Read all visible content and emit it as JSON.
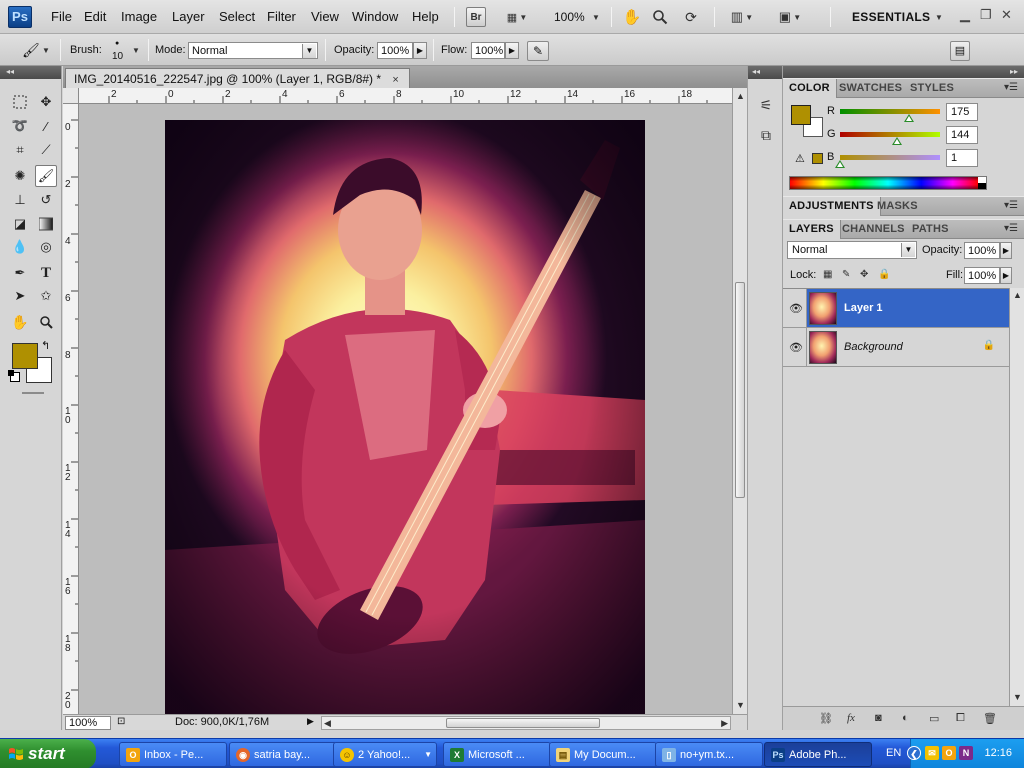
{
  "menubar": {
    "logo": "Ps",
    "items": [
      "File",
      "Edit",
      "Image",
      "Layer",
      "Select",
      "Filter",
      "View",
      "Window",
      "Help"
    ],
    "bridge_label": "Br",
    "zoom": "100%",
    "workspace": "ESSENTIALS"
  },
  "options": {
    "brush_label": "Brush:",
    "brush_size": "10",
    "mode_label": "Mode:",
    "mode_value": "Normal",
    "opacity_label": "Opacity:",
    "opacity_value": "100%",
    "flow_label": "Flow:",
    "flow_value": "100%"
  },
  "tools": {
    "foreground_color": "#af9001",
    "background_color": "#ffffff"
  },
  "document": {
    "tab_title": "IMG_20140516_222547.jpg @ 100% (Layer 1, RGB/8#) *",
    "close_glyph": "×",
    "ruler_h": [
      "2",
      "0",
      "2",
      "4",
      "6",
      "8",
      "10",
      "12",
      "14",
      "16",
      "18"
    ],
    "ruler_v": [
      "0",
      "2",
      "4",
      "6",
      "8",
      "10",
      "12",
      "14",
      "16",
      "18",
      "20"
    ],
    "zoom_field": "100%",
    "doc_info": "Doc: 900,0K/1,76M"
  },
  "color_panel": {
    "tabs": [
      "COLOR",
      "SWATCHES",
      "STYLES"
    ],
    "r_label": "R",
    "g_label": "G",
    "b_label": "B",
    "r_value": "175",
    "g_value": "144",
    "b_value": "1",
    "r_level": 0.686,
    "g_level": 0.565,
    "b_level": 0.004,
    "swatch": "#af9001"
  },
  "adjustments": {
    "tabs": [
      "ADJUSTMENTS",
      "MASKS"
    ]
  },
  "layers_panel": {
    "tabs": [
      "LAYERS",
      "CHANNELS",
      "PATHS"
    ],
    "blend_mode": "Normal",
    "opacity_label": "Opacity:",
    "opacity_value": "100%",
    "lock_label": "Lock:",
    "fill_label": "Fill:",
    "fill_value": "100%",
    "layers": [
      {
        "name": "Layer 1",
        "selected": true
      },
      {
        "name": "Background",
        "selected": false,
        "locked": true
      }
    ],
    "selection_color": "#3465c6"
  },
  "taskbar": {
    "start_label": "start",
    "tasks": [
      {
        "label": "Inbox - Pe...",
        "icon": "outlook-icon"
      },
      {
        "label": "satria bay...",
        "icon": "firefox-icon"
      },
      {
        "label": "2 Yahoo!...",
        "icon": "yahoo-messenger-icon"
      },
      {
        "label": "Microsoft ...",
        "icon": "excel-icon"
      },
      {
        "label": "My Docum...",
        "icon": "folder-icon"
      },
      {
        "label": "no+ym.tx...",
        "icon": "notepad-icon"
      },
      {
        "label": "Adobe Ph...",
        "icon": "photoshop-icon"
      }
    ],
    "language": "EN",
    "clock": "12:16"
  }
}
